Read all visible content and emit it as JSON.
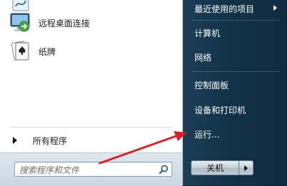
{
  "left_pane": {
    "programs": [
      {
        "label": "远程桌面连接",
        "icon": "remote-desktop-icon"
      },
      {
        "label": "纸牌",
        "icon": "solitaire-icon"
      }
    ],
    "all_programs_label": "所有程序",
    "search": {
      "placeholder": "搜索程序和文件",
      "icon": "search-icon"
    }
  },
  "right_pane": {
    "items": [
      {
        "label": "最近使用的项目",
        "has_submenu": true
      },
      {
        "label": "计算机"
      },
      {
        "label": "网络"
      },
      {
        "label": "控制面板"
      },
      {
        "label": "设备和打印机"
      },
      {
        "label": "运行..."
      }
    ],
    "shutdown_label": "关机"
  },
  "colors": {
    "right_pane": "#123349",
    "annotation_arrow": "#e02020"
  }
}
